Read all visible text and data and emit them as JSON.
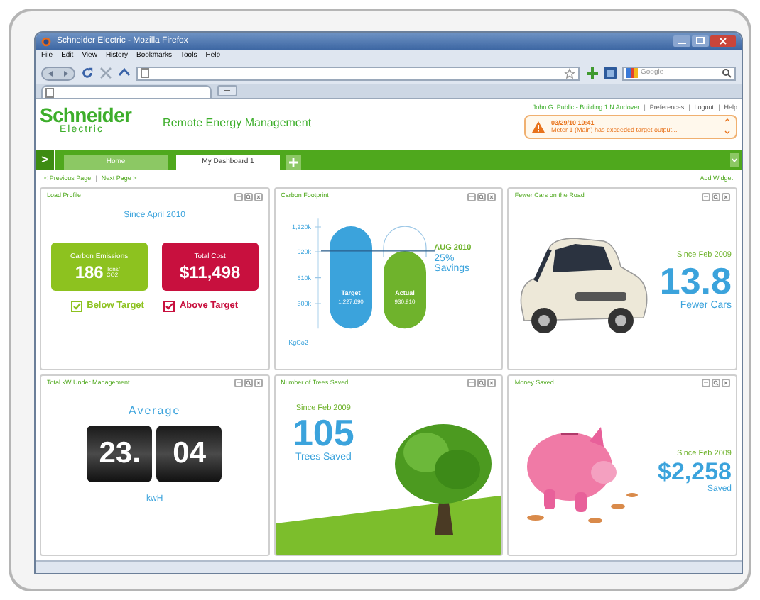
{
  "window": {
    "title": "Schneider Electric - Mozilla Firefox"
  },
  "menu": [
    "File",
    "Edit",
    "View",
    "History",
    "Bookmarks",
    "Tools",
    "Help"
  ],
  "search": {
    "placeholder": "Google"
  },
  "header": {
    "logo": "Schneider",
    "logo_sub": "Electric",
    "product": "Remote Energy Management",
    "user": "John G. Public - Building 1 N Andover",
    "links": [
      {
        "separator": "|",
        "label": "Preferences"
      },
      {
        "separator": "|",
        "label": "Logout"
      },
      {
        "separator": "|",
        "label": "Help"
      }
    ]
  },
  "alert": {
    "time": "03/29/10 10:41",
    "message": "Meter 1 (Main) has exceeded target output..."
  },
  "expand_button": ">",
  "tabs": [
    {
      "label": "Home",
      "selected": false
    },
    {
      "label": "My Dashboard 1",
      "selected": true
    }
  ],
  "nav": {
    "previous": "< Previous Page",
    "separator": "|",
    "next": "Next Page >",
    "add": "Add Widget"
  },
  "widgets": [
    {
      "kind": "load",
      "title": "Load Profile",
      "since": "Since April 2010",
      "cards": [
        {
          "label": "Carbon Emissions",
          "value": "186",
          "unit": "Tons/ CO2",
          "color": "#8dc21f"
        },
        {
          "label": "Total Cost",
          "value": "$11,498",
          "color": "#c8103e"
        }
      ],
      "checks": [
        {
          "label": "Below Target",
          "checked": true,
          "color": "#8dc21f"
        },
        {
          "label": "Above Target",
          "checked": true,
          "color": "#c8103e"
        }
      ]
    },
    {
      "kind": "carbon",
      "title": "Carbon Footprint",
      "note_date": "AUG 2010",
      "note_value": "25%",
      "note_label": "Savings",
      "chart_data": {
        "type": "bar",
        "ylabel": "KgCo2",
        "categories": [
          "Target",
          "Actual"
        ],
        "values": [
          1227690,
          930910
        ],
        "value_labels": [
          "1,227,690",
          "930,910"
        ],
        "ylim": [
          0,
          1320000
        ],
        "yticks": [
          {
            "value": 1220000,
            "label": "1,220k"
          },
          {
            "value": 920000,
            "label": "920k"
          },
          {
            "value": 610000,
            "label": "610k"
          },
          {
            "value": 300000,
            "label": "300k"
          }
        ]
      }
    },
    {
      "kind": "cars",
      "title": "Fewer Cars on the Road",
      "since": "Since Feb 2009",
      "value": "13.8",
      "caption": "Fewer Cars"
    },
    {
      "kind": "kw",
      "title": "Total kW Under Management",
      "label": "Average",
      "digits": [
        "23.",
        "04"
      ],
      "unit": "kwH"
    },
    {
      "kind": "trees",
      "title": "Number of Trees Saved",
      "since": "Since Feb 2009",
      "value": "105",
      "caption": "Trees Saved"
    },
    {
      "kind": "money",
      "title": "Money Saved",
      "since": "Since Feb 2009",
      "value": "$2,258",
      "caption": "Saved"
    }
  ]
}
